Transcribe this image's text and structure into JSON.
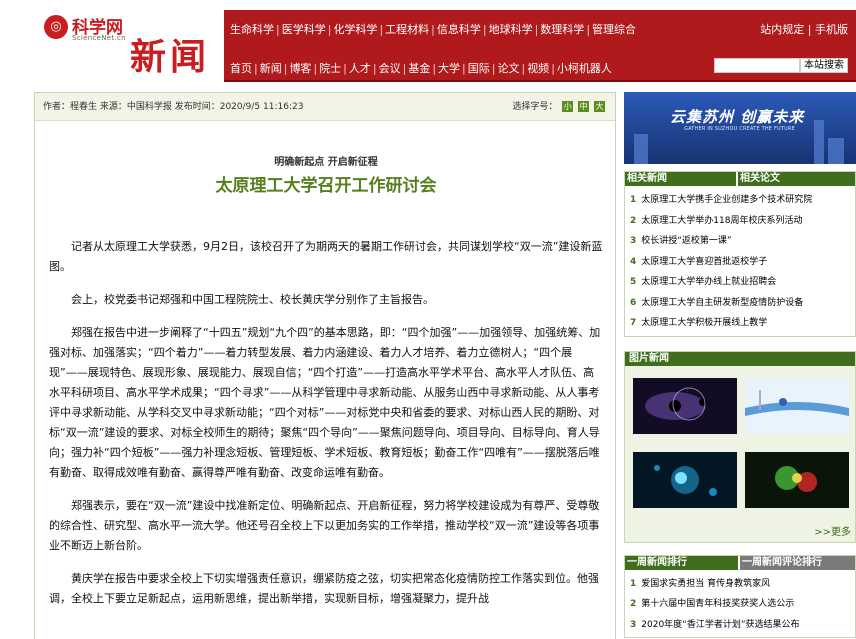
{
  "header": {
    "logo_mark": "◎",
    "logo_text": "科学网",
    "logo_sub": "ScienceNet.cn",
    "section": "新闻",
    "nav1": [
      "生命科学",
      "医学科学",
      "化学科学",
      "工程材料",
      "信息科学",
      "地球科学",
      "数理科学",
      "管理综合"
    ],
    "nav2": [
      "首页",
      "新闻",
      "博客",
      "院士",
      "人才",
      "会议",
      "基金",
      "大学",
      "国际",
      "论文",
      "视频",
      "小柯机器人"
    ],
    "utility": "站内规定 | 手机版",
    "search_button": "本站搜索",
    "search_value": ""
  },
  "article": {
    "meta": "作者：程春生  来源：中国科学报  发布时间：2020/9/5 11:16:23",
    "font_label": "选择字号：",
    "font_sizes": [
      "小",
      "中",
      "大"
    ],
    "kicker": "明确新起点  开启新征程",
    "headline": "太原理工大学召开工作研讨会",
    "paragraphs": [
      "记者从太原理工大学获悉，9月2日，该校召开了为期两天的暑期工作研讨会，共同谋划学校“双一流”建设新蓝图。",
      "会上，校党委书记郑强和中国工程院院士、校长黄庆学分别作了主旨报告。",
      "郑强在报告中进一步阐释了“十四五”规划“九个四”的基本思路，即：“四个加强”——加强领导、加强统筹、加强对标、加强落实；“四个着力”——着力转型发展、着力内涵建设、着力人才培养、着力立德树人；“四个展现”——展现特色、展现形象、展现能力、展现自信；“四个打造”——打造高水平学术平台、高水平人才队伍、高水平科研项目、高水平学术成果；“四个寻求”——从科学管理中寻求新动能、从服务山西中寻求新动能、从人事考评中寻求新动能、从学科交叉中寻求新动能；“四个对标”——对标党中央和省委的要求、对标山西人民的期盼、对标“双一流”建设的要求、对标全校师生的期待；聚焦“四个导向”——聚焦问题导向、项目导向、目标导向、育人导向；强力补“四个短板”——强力补理念短板、管理短板、学术短板、教育短板；勤奋工作“四唯有”——摆脱落后唯有勤奋、取得成效唯有勤奋、赢得尊严唯有勤奋、改变命运唯有勤奋。",
      "郑强表示，要在“双一流”建设中找准新定位、明确新起点、开启新征程，努力将学校建设成为有尊严、受尊敬的综合性、研究型、高水平一流大学。他还号召全校上下以更加务实的工作举措，推动学校“双一流”建设等各项事业不断迈上新台阶。",
      "黄庆学在报告中要求全校上下切实增强责任意识，绷紧防疫之弦，切实把常态化疫情防控工作落实到位。他强调，全校上下要立足新起点，运用新思维，提出新举措，实现新目标，增强凝聚力，提升战"
    ]
  },
  "sidebar": {
    "banner_text": "云集苏州 创赢未来",
    "banner_sub": "GATHER IN SUZHOU CREATE THE FUTURE",
    "related_tabs": [
      "相关新闻",
      "相关论文"
    ],
    "related": [
      "太原理工大学携手企业创建多个技术研究院",
      "太原理工大学举办118周年校庆系列活动",
      "校长讲授“返校第一课”",
      "太原理工大学喜迎首批返校学子",
      "太原理工大学举办线上就业招聘会",
      "太原理工大学自主研发新型疫情防护设备",
      "太原理工大学积极开展线上教学"
    ],
    "photo_title": "图片新闻",
    "photo_more": ">>更多",
    "rank_tabs": [
      "一周新闻排行",
      "一周新闻评论排行"
    ],
    "rank": [
      "爱国求实勇担当 育传身教筑家风",
      "第十六届中国青年科技奖获奖人选公示",
      "2020年度“香江学者计划”获选结果公布"
    ]
  }
}
